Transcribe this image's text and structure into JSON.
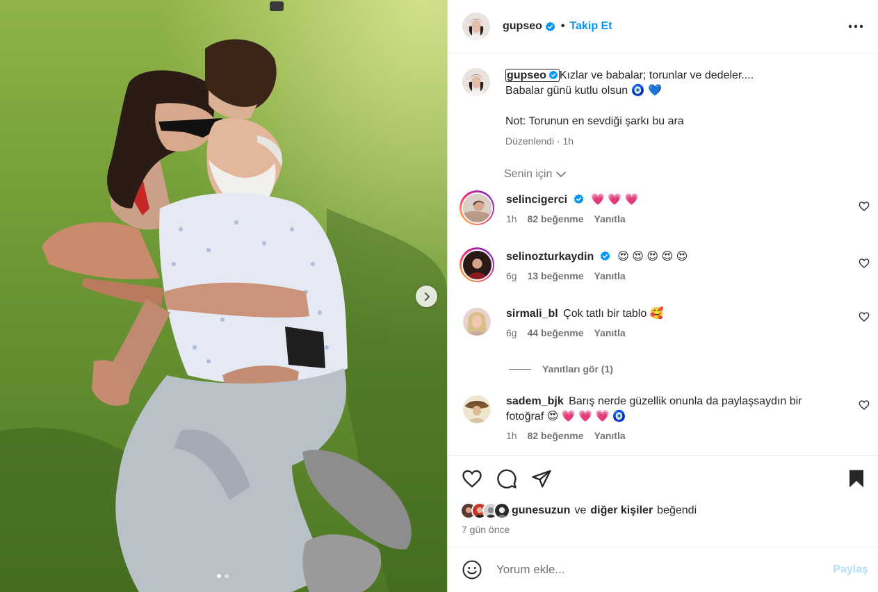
{
  "post": {
    "photo_alt": "",
    "carousel": {
      "total": 2,
      "active": 1
    }
  },
  "author": {
    "username": "gupseo",
    "verified": true,
    "separator": "•",
    "follow_label": "Takip Et"
  },
  "caption": {
    "username": "gupseo",
    "line1": "Kızlar ve babalar; torunlar ve dedeler....",
    "line2": "Babalar günü kutlu olsun 🧿 💙",
    "line3": "Not: Torunun en sevdiği şarkı bu ara",
    "edited_label": "Düzenlendi",
    "meta_sep": "·",
    "time": "1h"
  },
  "for_you": {
    "label": "Senin için"
  },
  "comments": [
    {
      "username": "selincigerci",
      "verified": true,
      "text": "💗 💗 💗",
      "time": "1h",
      "likes": "82 beğenme",
      "reply": "Yanıtla",
      "story_ring": true
    },
    {
      "username": "selinozturkaydin",
      "verified": true,
      "text": "😍 😍 😍 😍 😍",
      "time": "6g",
      "likes": "13 beğenme",
      "reply": "Yanıtla",
      "story_ring": true
    },
    {
      "username": "sirmali_bl",
      "verified": false,
      "text": "Çok tatlı bir tablo 🥰",
      "time": "6g",
      "likes": "44 beğenme",
      "reply": "Yanıtla",
      "story_ring": false
    },
    {
      "username": "sadem_bjk",
      "verified": false,
      "text": "Barış nerde güzellik onunla da paylaşsaydın bir fotoğraf 😍 💗 💗 💗 🧿",
      "time": "1h",
      "likes": "82 beğenme",
      "reply": "Yanıtla",
      "story_ring": false
    }
  ],
  "view_replies": {
    "label": "Yanıtları gör (1)"
  },
  "likes": {
    "first_user": "gunesuzun",
    "connector": "ve",
    "others": "diğer kişiler",
    "suffix": "beğendi"
  },
  "post_date": "7 gün önce",
  "add_comment": {
    "placeholder": "Yorum ekle...",
    "post_label": "Paylaş"
  },
  "colors": {
    "link_blue": "#0095f6",
    "post_disabled": "#b2dffc",
    "muted": "#737373",
    "text": "#262626",
    "verified": "#0095f6"
  },
  "icons": [
    "more-icon",
    "verified-icon",
    "chevron-down-icon",
    "heart-icon",
    "comment-icon",
    "share-icon",
    "bookmark-icon",
    "emoji-icon",
    "chevron-right-icon"
  ]
}
